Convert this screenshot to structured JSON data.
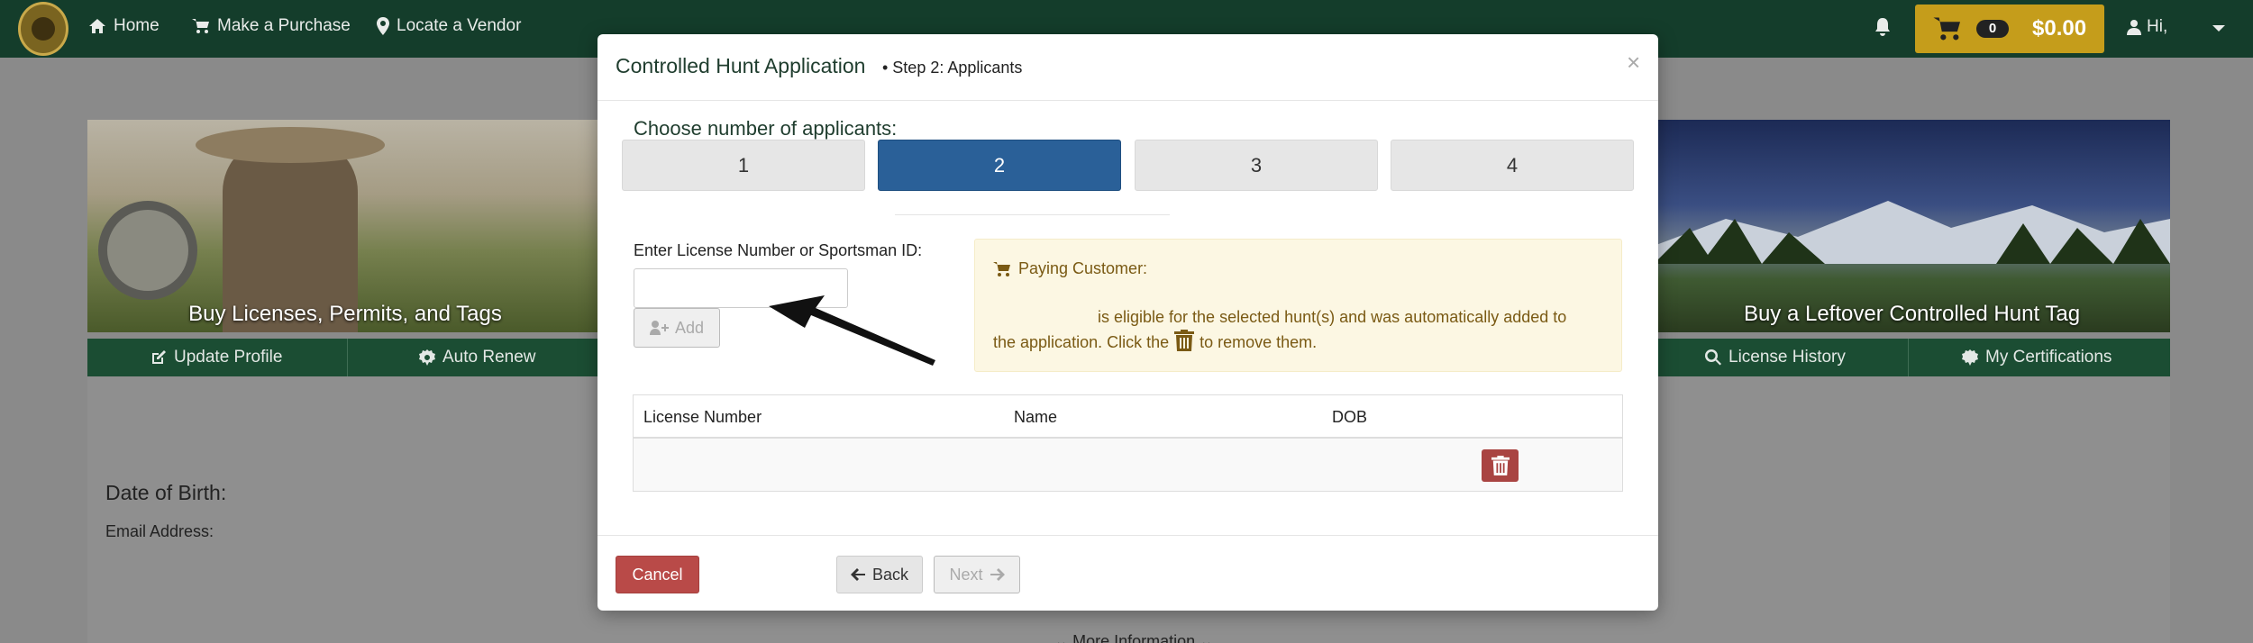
{
  "nav": {
    "home": "Home",
    "purchase": "Make a Purchase",
    "vendor": "Locate a Vendor",
    "cart_count": "0",
    "cart_total": "$0.00",
    "greeting": "Hi,"
  },
  "banners": {
    "left_caption": "Buy Licenses, Permits, and Tags",
    "right_caption": "Buy a Leftover Controlled Hunt Tag"
  },
  "greenbar": {
    "update_profile": "Update Profile",
    "auto_renew": "Auto Renew",
    "license_history": "License History",
    "certifications": "My Certifications"
  },
  "page": {
    "dob_label": "Date of Birth:",
    "email_label": "Email Address:",
    "more_info": "⌄ More Information ⌄"
  },
  "modal": {
    "title": "Controlled Hunt Application",
    "step": "•  Step 2: Applicants",
    "close": "×",
    "choose_label": "Choose number of applicants:",
    "applicant_options": [
      "1",
      "2",
      "3",
      "4"
    ],
    "selected": "2",
    "license_label": "Enter License Number or Sportsman ID:",
    "add_label": "Add",
    "paying_title": "Paying Customer:",
    "paying_line1": "is eligible for the selected hunt(s) and was automatically added to",
    "paying_line2a": "the application. Click the",
    "paying_line2b": "to remove them.",
    "table_headers": [
      "License Number",
      "Name",
      "DOB"
    ],
    "cancel": "Cancel",
    "back": "Back",
    "next": "Next"
  }
}
